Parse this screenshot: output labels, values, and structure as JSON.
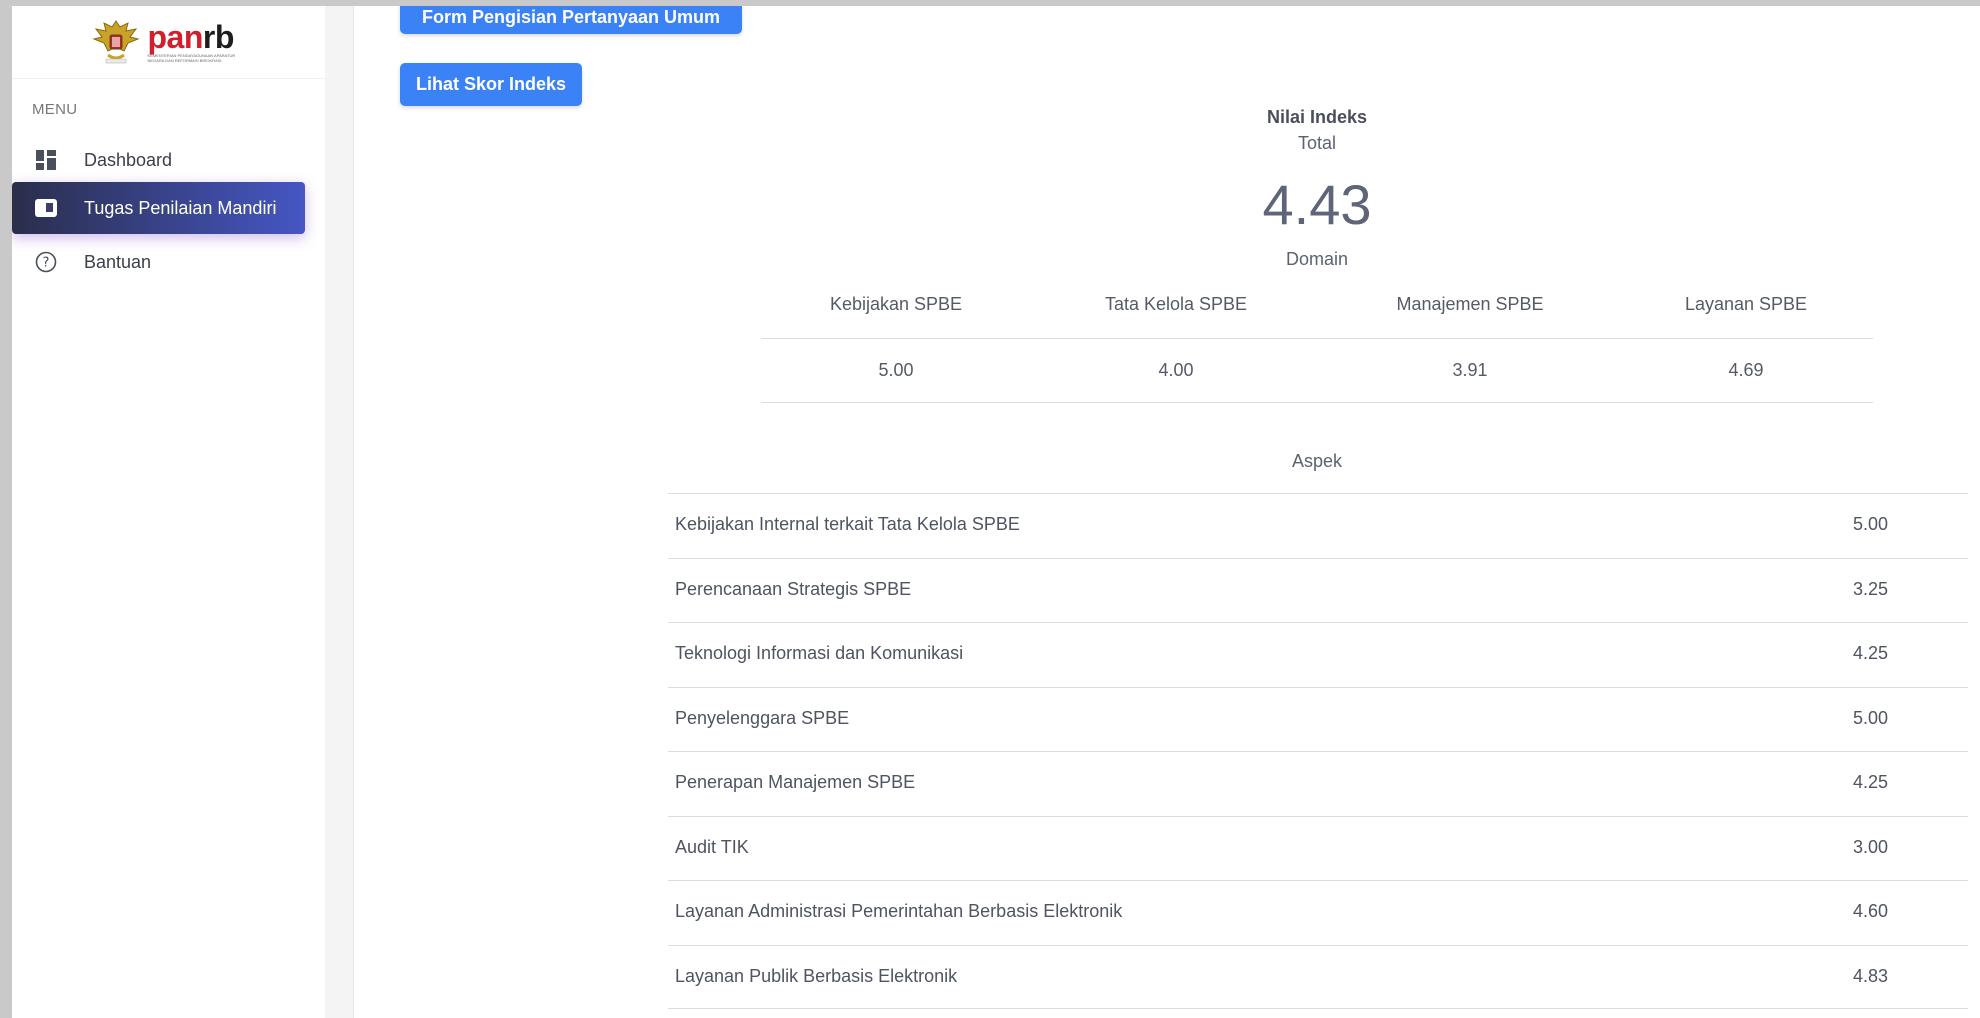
{
  "sidebar": {
    "logo_text_pan": "pan",
    "logo_text_rb": "rb",
    "logo_sub": "KEMENTERIAN PENDAYAGUNAAN APARATUR NEGARA DAN REFORMASI BIROKRASI",
    "menu_heading": "MENU",
    "items": [
      {
        "label": "Dashboard",
        "icon": "dashboard-icon"
      },
      {
        "label": "Tugas Penilaian Mandiri",
        "icon": "task-card-icon",
        "active": true
      },
      {
        "label": "Bantuan",
        "icon": "help-circle-icon"
      }
    ]
  },
  "buttons": {
    "form_umum": "Form Pengisian Pertanyaan Umum",
    "lihat_skor": "Lihat Skor Indeks"
  },
  "index": {
    "title": "Nilai Indeks",
    "total_label": "Total",
    "total_value": "4.43",
    "domain_label": "Domain"
  },
  "domains": [
    {
      "name": "Kebijakan SPBE",
      "value": "5.00"
    },
    {
      "name": "Tata Kelola SPBE",
      "value": "4.00"
    },
    {
      "name": "Manajemen SPBE",
      "value": "3.91"
    },
    {
      "name": "Layanan SPBE",
      "value": "4.69"
    }
  ],
  "aspek_label": "Aspek",
  "aspek": [
    {
      "name": "Kebijakan Internal terkait Tata Kelola SPBE",
      "value": "5.00"
    },
    {
      "name": "Perencanaan Strategis SPBE",
      "value": "3.25"
    },
    {
      "name": "Teknologi Informasi dan Komunikasi",
      "value": "4.25"
    },
    {
      "name": "Penyelenggara SPBE",
      "value": "5.00"
    },
    {
      "name": "Penerapan Manajemen SPBE",
      "value": "4.25"
    },
    {
      "name": "Audit TIK",
      "value": "3.00"
    },
    {
      "name": "Layanan Administrasi Pemerintahan Berbasis Elektronik",
      "value": "4.60"
    },
    {
      "name": "Layanan Publik Berbasis Elektronik",
      "value": "4.83"
    }
  ],
  "colors": {
    "primary_button": "#3b82f6",
    "active_nav_start": "#2a2e4a",
    "active_nav_end": "#4656c4",
    "brand_red": "#d0202e"
  }
}
